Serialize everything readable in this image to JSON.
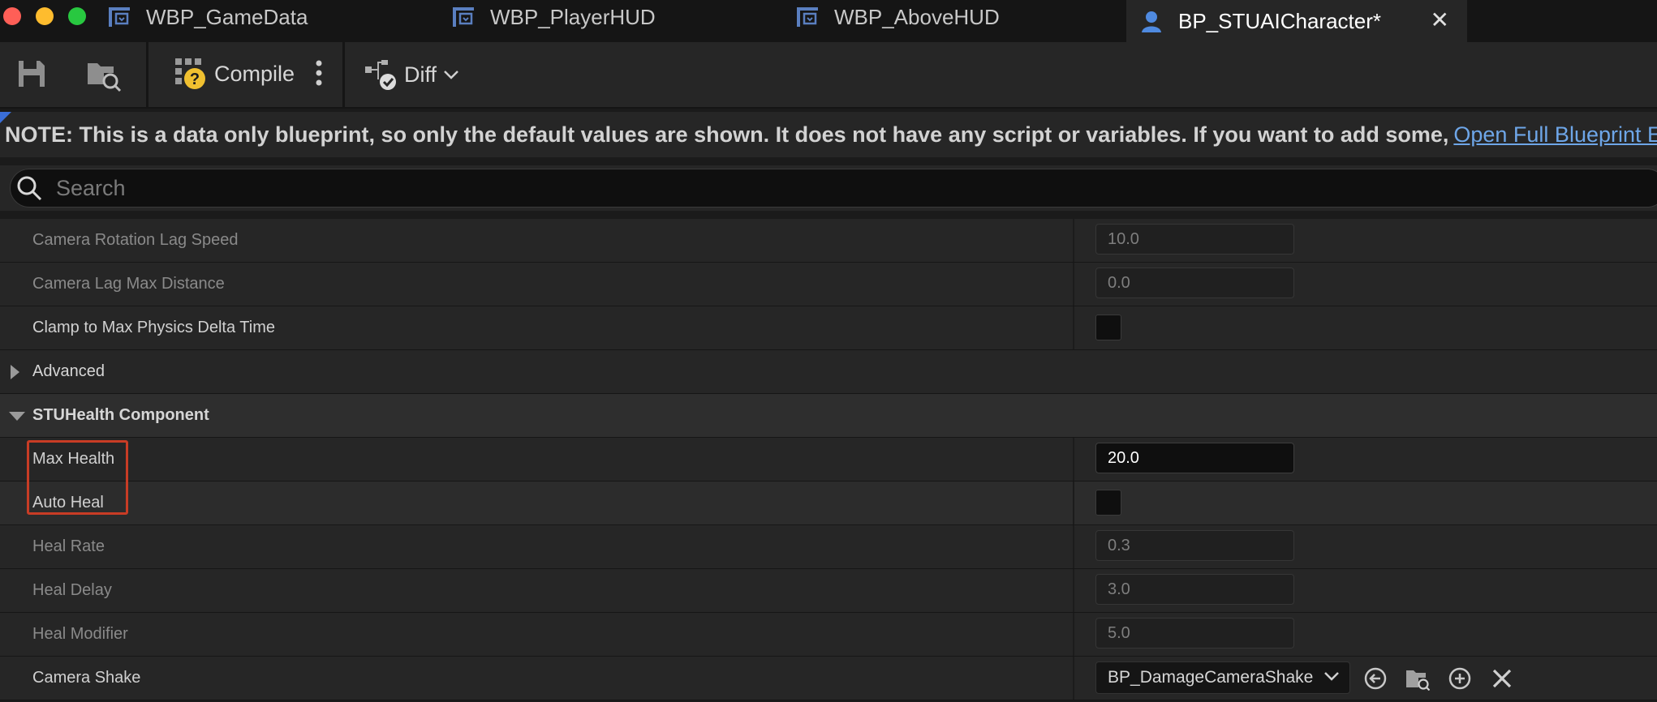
{
  "window": {
    "traffic_colors": [
      "#ff5f57",
      "#febc2e",
      "#28c840"
    ]
  },
  "tabs": [
    {
      "label": "WBP_GameData",
      "icon": "widget-blueprint-icon"
    },
    {
      "label": "WBP_PlayerHUD",
      "icon": "widget-blueprint-icon"
    },
    {
      "label": "WBP_AboveHUD",
      "icon": "widget-blueprint-icon"
    },
    {
      "label": "BP_STUAICharacter*",
      "icon": "character-icon",
      "active": true
    }
  ],
  "toolbar": {
    "save_icon": "save-icon",
    "browse_icon": "browse-folder-icon",
    "compile_label": "Compile",
    "diff_label": "Diff"
  },
  "note": {
    "text": "NOTE: This is a data only blueprint, so only the default values are shown.  It does not have any script or variables.  If you want to add some,",
    "link": "Open Full Blueprint Editor"
  },
  "search": {
    "placeholder": "Search"
  },
  "rows": {
    "camera_rotation_lag_speed": {
      "label": "Camera Rotation Lag Speed",
      "value": "10.0"
    },
    "camera_lag_max_distance": {
      "label": "Camera Lag Max Distance",
      "value": "0.0"
    },
    "clamp_delta_time": {
      "label": "Clamp to Max Physics Delta Time",
      "checked": false
    },
    "advanced": {
      "label": "Advanced"
    },
    "stuhealth_section": {
      "label": "STUHealth Component"
    },
    "max_health": {
      "label": "Max Health",
      "value": "20.0"
    },
    "auto_heal": {
      "label": "Auto Heal",
      "checked": false
    },
    "heal_rate": {
      "label": "Heal Rate",
      "value": "0.3"
    },
    "heal_delay": {
      "label": "Heal Delay",
      "value": "3.0"
    },
    "heal_modifier": {
      "label": "Heal Modifier",
      "value": "5.0"
    },
    "camera_shake": {
      "label": "Camera Shake",
      "value": "BP_DamageCameraShake"
    }
  },
  "colors": {
    "accent_link": "#6ea6e8",
    "highlight_box": "#c83c25",
    "compile_warning": "#f0c030"
  }
}
